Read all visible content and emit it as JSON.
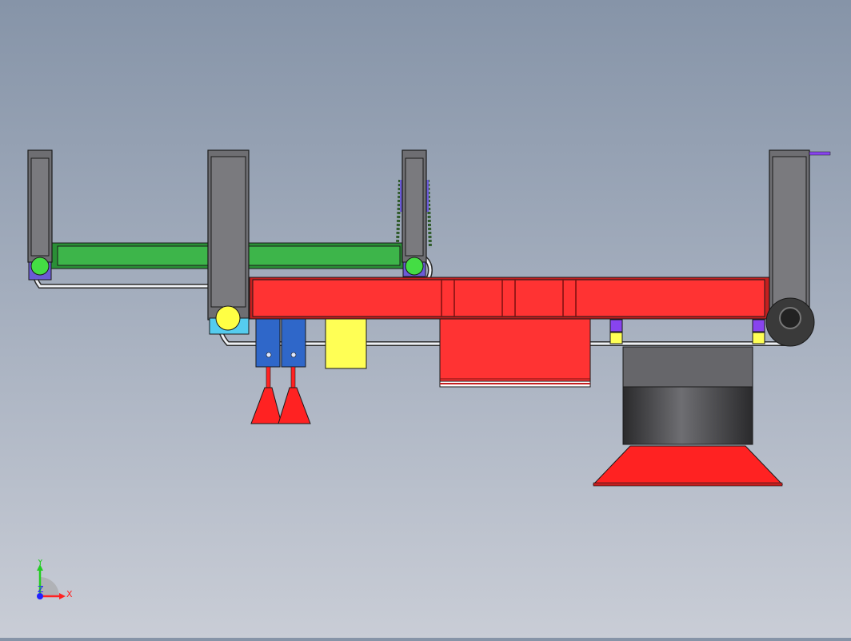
{
  "viewport": {
    "background_top": "#8694a8",
    "background_bottom": "#c9cdd6"
  },
  "model": {
    "colors": {
      "frame_gray": "#6e6e72",
      "frame_inner": "#7a7a7e",
      "outline": "#1a1a1a",
      "beam_red": "#ff3333",
      "beam_red_dark": "#c41f1f",
      "arm_green": "#3db54a",
      "arm_green_dark": "#2a8f36",
      "wheel_green": "#44dd44",
      "wheel_yellow": "#ffff44",
      "block_yellow": "#ffff55",
      "bracket_blue": "#2f67c9",
      "bracket_cyan": "#55ccee",
      "tab_purple": "#8844ee",
      "hub_purple": "#6b5bd6",
      "belt_white": "#eef0f4",
      "cup_red": "#ff2222"
    }
  },
  "triad": {
    "x_label": "X",
    "y_label": "Y",
    "z_label": "Z",
    "x_color": "#ff2222",
    "y_color": "#22cc22",
    "z_color": "#2222ff"
  }
}
